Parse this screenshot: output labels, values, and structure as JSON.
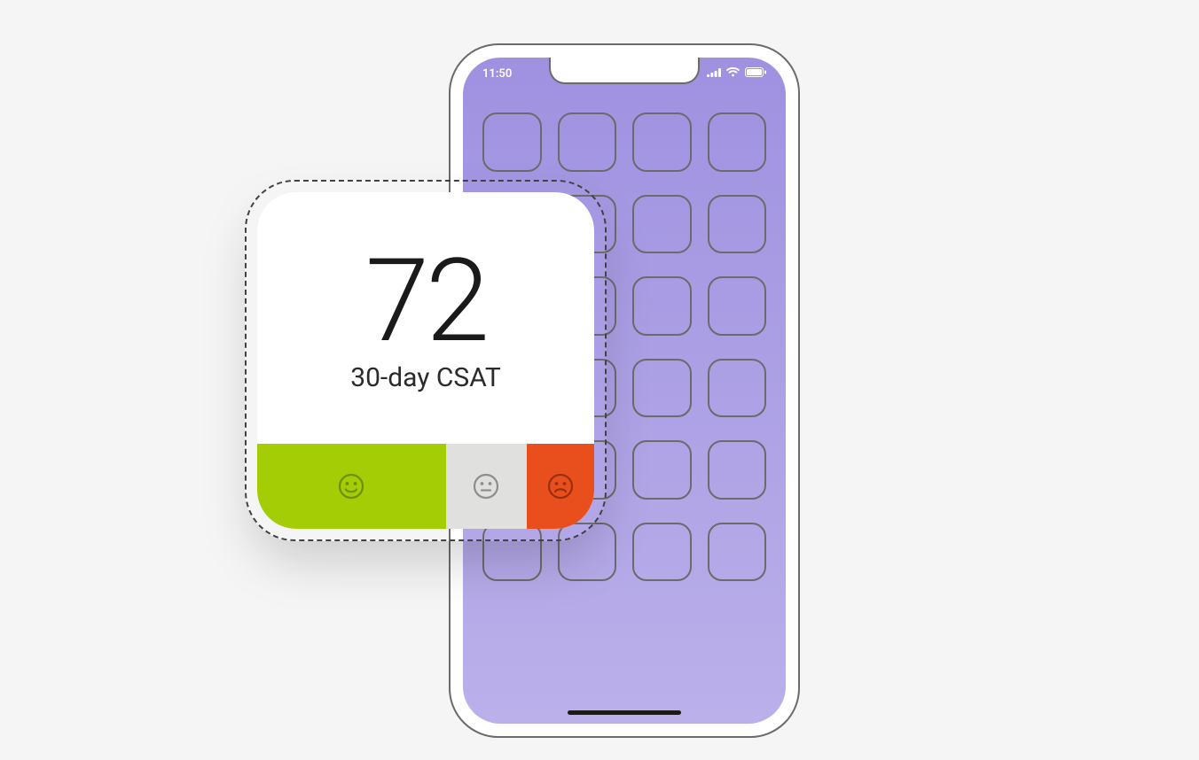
{
  "phone": {
    "status_time": "11:50",
    "home_app_count": 24
  },
  "widget": {
    "score": "72",
    "label": "30-day CSAT",
    "segments": {
      "positive": {
        "percent": 56,
        "color": "#a4cd05",
        "icon": "smile"
      },
      "neutral": {
        "percent": 24,
        "color": "#e0e0de",
        "icon": "meh"
      },
      "negative": {
        "percent": 20,
        "color": "#e94f1d",
        "icon": "frown"
      }
    }
  }
}
